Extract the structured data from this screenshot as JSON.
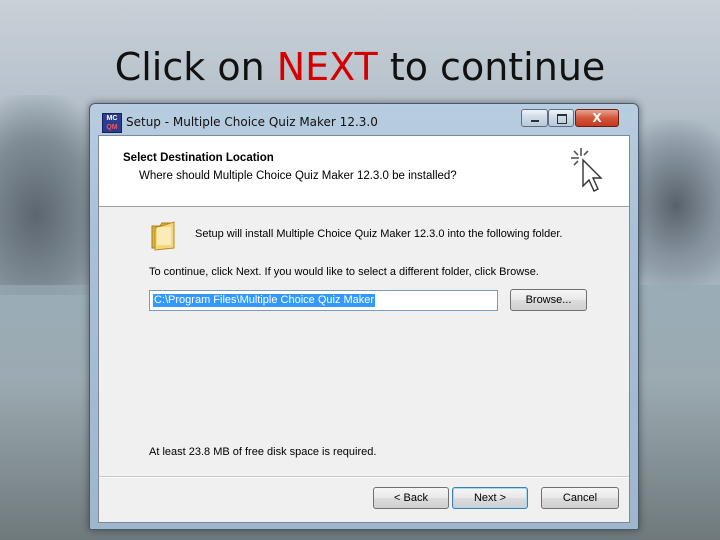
{
  "slide": {
    "title_prefix": "Click on ",
    "title_highlight": "NEXT",
    "title_suffix": " to continue",
    "highlight_color": "#d40000"
  },
  "window": {
    "icon_text_top": "MC",
    "icon_text_bottom": "QM",
    "title": "Setup - Multiple Choice Quiz Maker 12.3.0",
    "controls": {
      "minimize_icon": "minimize-icon",
      "maximize_icon": "maximize-icon",
      "close_label": "X"
    }
  },
  "header": {
    "title": "Select Destination Location",
    "subtitle": "Where should Multiple Choice Quiz Maker 12.3.0 be installed?",
    "icon": "wizard-cursor-icon"
  },
  "body": {
    "folder_icon": "folder-icon",
    "install_text": "Setup will install Multiple Choice Quiz Maker 12.3.0 into the following folder.",
    "continue_text": "To continue, click Next. If you would like to select a different folder, click Browse.",
    "path_value": "C:\\Program Files\\Multiple Choice Quiz Maker",
    "browse_label": "Browse...",
    "disk_space_text": "At least 23.8 MB of free disk space is required."
  },
  "footer": {
    "back_label": "< Back",
    "next_label": "Next >",
    "cancel_label": "Cancel"
  }
}
